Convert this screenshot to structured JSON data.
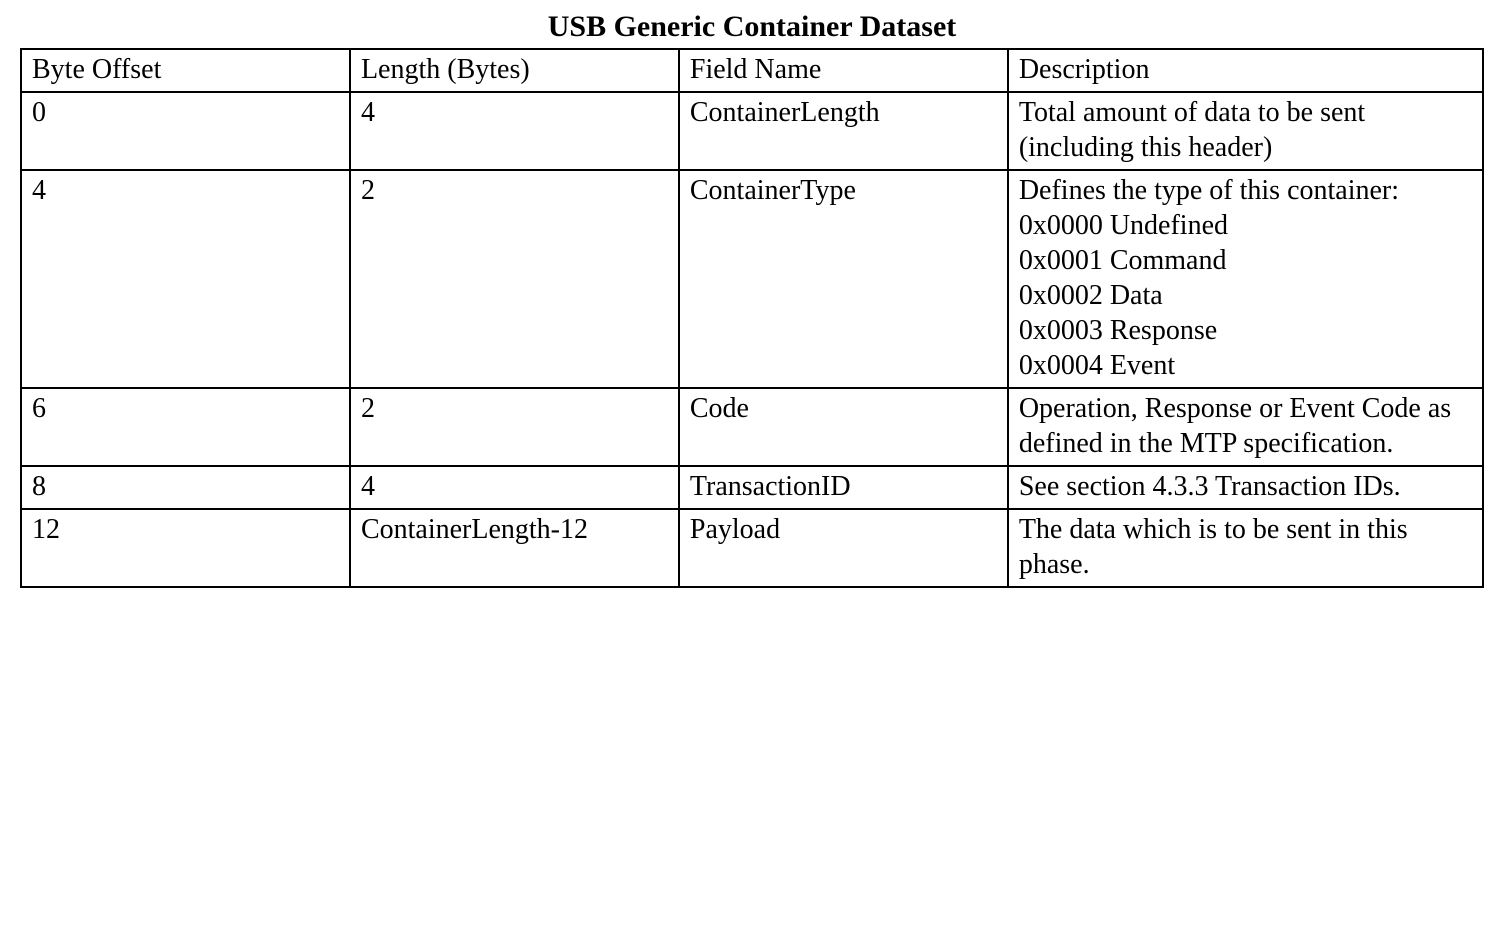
{
  "title": "USB Generic Container Dataset",
  "headers": {
    "col0": "Byte Offset",
    "col1": "Length (Bytes)",
    "col2": "Field Name",
    "col3": "Description"
  },
  "rows": [
    {
      "byte_offset": "0",
      "length": "4",
      "field_name": "ContainerLength",
      "description": "Total amount of data to be sent (including this header)"
    },
    {
      "byte_offset": "4",
      "length": "2",
      "field_name": "ContainerType",
      "description": "Defines the type of this container:\n0x0000 Undefined\n0x0001 Command\n0x0002 Data\n0x0003 Response\n0x0004 Event"
    },
    {
      "byte_offset": "6",
      "length": "2",
      "field_name": "Code",
      "description": "Operation, Response or Event Code as defined in the MTP specification."
    },
    {
      "byte_offset": "8",
      "length": "4",
      "field_name": "TransactionID",
      "description": "See section 4.3.3 Transaction IDs."
    },
    {
      "byte_offset": "12",
      "length": "ContainerLength-12",
      "field_name": "Payload",
      "description": "The data which is to be sent in this phase."
    }
  ]
}
